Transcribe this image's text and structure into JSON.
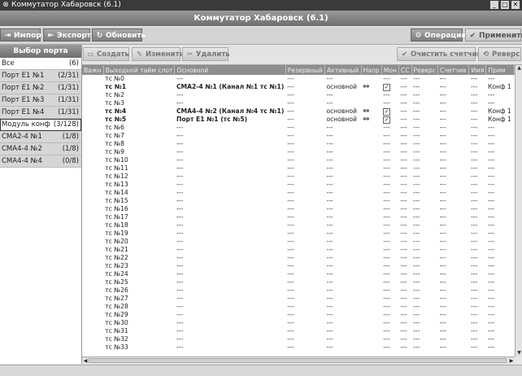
{
  "window": {
    "title": "Коммутатор Хабаровск (6.1)"
  },
  "app": {
    "header": "Коммутатор Хабаровск (6.1)"
  },
  "toolbar": {
    "import": "Импорт",
    "export": "Экспорт",
    "refresh": "Обновить",
    "operations": "Операции",
    "apply": "Применить"
  },
  "sidebar": {
    "header": "Выбор порта",
    "ports": [
      {
        "label": "Все",
        "count": "(6)"
      },
      {
        "label": "Порт E1 №1",
        "count": "(2/31)"
      },
      {
        "label": "Порт E1 №2",
        "count": "(1/31)"
      },
      {
        "label": "Порт E1 №3",
        "count": "(1/31)"
      },
      {
        "label": "Порт E1 №4",
        "count": "(1/31)"
      },
      {
        "label": "Модуль конф",
        "count": "(3/128)"
      },
      {
        "label": "СМА2-4 №1",
        "count": "(1/8)"
      },
      {
        "label": "СМА4-4 №2",
        "count": "(1/8)"
      },
      {
        "label": "СМА4-4 №4",
        "count": "(0/8)"
      }
    ]
  },
  "actions": {
    "create": "Создать",
    "edit": "Изменить",
    "delete": "Удалить",
    "clear_counter": "Очистить счетчик",
    "reverse": "Реверс"
  },
  "table": {
    "columns": [
      "Важн",
      "Выходной тайм слот",
      "Основной",
      "Резервный",
      "Активный",
      "Напр",
      "Мон",
      "СС",
      "Реверс",
      "Счетчик",
      "Имя",
      "Прим"
    ],
    "rows": [
      {
        "slot": "тс №0",
        "main": "---",
        "reserve": "---",
        "active": "---",
        "dir": "",
        "mon": "---",
        "cc": "---",
        "rev": "---",
        "cnt": "---",
        "name": "---",
        "note": "---"
      },
      {
        "slot": "тс №1",
        "main": "СМА2-4 №1 (Канал №1 тс №1)",
        "reserve": "---",
        "active": "основной",
        "dir": "⇔",
        "mon": "✓",
        "cc": "---",
        "rev": "---",
        "cnt": "---",
        "name": "---",
        "note": "Конф 1"
      },
      {
        "slot": "тс №2",
        "main": "---",
        "reserve": "---",
        "active": "---",
        "dir": "",
        "mon": "---",
        "cc": "---",
        "rev": "---",
        "cnt": "---",
        "name": "---",
        "note": "---"
      },
      {
        "slot": "тс №3",
        "main": "---",
        "reserve": "---",
        "active": "---",
        "dir": "",
        "mon": "---",
        "cc": "---",
        "rev": "---",
        "cnt": "---",
        "name": "---",
        "note": "---"
      },
      {
        "slot": "тс №4",
        "main": "СМА4-4 №2 (Канал №4 тс №1)",
        "reserve": "---",
        "active": "основной",
        "dir": "⇔",
        "mon": "✓",
        "cc": "---",
        "rev": "---",
        "cnt": "---",
        "name": "---",
        "note": "Конф 1"
      },
      {
        "slot": "тс №5",
        "main": "Порт E1 №1 (тс №5)",
        "reserve": "---",
        "active": "основной",
        "dir": "⇔",
        "mon": "✓",
        "cc": "---",
        "rev": "---",
        "cnt": "---",
        "name": "---",
        "note": "Конф 1"
      },
      {
        "slot": "тс №6",
        "main": "---",
        "reserve": "---",
        "active": "---",
        "dir": "",
        "mon": "---",
        "cc": "---",
        "rev": "---",
        "cnt": "---",
        "name": "---",
        "note": "---"
      },
      {
        "slot": "тс №7",
        "main": "---",
        "reserve": "---",
        "active": "---",
        "dir": "",
        "mon": "---",
        "cc": "---",
        "rev": "---",
        "cnt": "---",
        "name": "---",
        "note": "---"
      },
      {
        "slot": "тс №8",
        "main": "---",
        "reserve": "---",
        "active": "---",
        "dir": "",
        "mon": "---",
        "cc": "---",
        "rev": "---",
        "cnt": "---",
        "name": "---",
        "note": "---"
      },
      {
        "slot": "тс №9",
        "main": "---",
        "reserve": "---",
        "active": "---",
        "dir": "",
        "mon": "---",
        "cc": "---",
        "rev": "---",
        "cnt": "---",
        "name": "---",
        "note": "---"
      },
      {
        "slot": "тс №10",
        "main": "---",
        "reserve": "---",
        "active": "---",
        "dir": "",
        "mon": "---",
        "cc": "---",
        "rev": "---",
        "cnt": "---",
        "name": "---",
        "note": "---"
      },
      {
        "slot": "тс №11",
        "main": "---",
        "reserve": "---",
        "active": "---",
        "dir": "",
        "mon": "---",
        "cc": "---",
        "rev": "---",
        "cnt": "---",
        "name": "---",
        "note": "---"
      },
      {
        "slot": "тс №12",
        "main": "---",
        "reserve": "---",
        "active": "---",
        "dir": "",
        "mon": "---",
        "cc": "---",
        "rev": "---",
        "cnt": "---",
        "name": "---",
        "note": "---"
      },
      {
        "slot": "тс №13",
        "main": "---",
        "reserve": "---",
        "active": "---",
        "dir": "",
        "mon": "---",
        "cc": "---",
        "rev": "---",
        "cnt": "---",
        "name": "---",
        "note": "---"
      },
      {
        "slot": "тс №14",
        "main": "---",
        "reserve": "---",
        "active": "---",
        "dir": "",
        "mon": "---",
        "cc": "---",
        "rev": "---",
        "cnt": "---",
        "name": "---",
        "note": "---"
      },
      {
        "slot": "тс №15",
        "main": "---",
        "reserve": "---",
        "active": "---",
        "dir": "",
        "mon": "---",
        "cc": "---",
        "rev": "---",
        "cnt": "---",
        "name": "---",
        "note": "---"
      },
      {
        "slot": "тс №16",
        "main": "---",
        "reserve": "---",
        "active": "---",
        "dir": "",
        "mon": "---",
        "cc": "---",
        "rev": "---",
        "cnt": "---",
        "name": "---",
        "note": "---"
      },
      {
        "slot": "тс №17",
        "main": "---",
        "reserve": "---",
        "active": "---",
        "dir": "",
        "mon": "---",
        "cc": "---",
        "rev": "---",
        "cnt": "---",
        "name": "---",
        "note": "---"
      },
      {
        "slot": "тс №18",
        "main": "---",
        "reserve": "---",
        "active": "---",
        "dir": "",
        "mon": "---",
        "cc": "---",
        "rev": "---",
        "cnt": "---",
        "name": "---",
        "note": "---"
      },
      {
        "slot": "тс №19",
        "main": "---",
        "reserve": "---",
        "active": "---",
        "dir": "",
        "mon": "---",
        "cc": "---",
        "rev": "---",
        "cnt": "---",
        "name": "---",
        "note": "---"
      },
      {
        "slot": "тс №20",
        "main": "---",
        "reserve": "---",
        "active": "---",
        "dir": "",
        "mon": "---",
        "cc": "---",
        "rev": "---",
        "cnt": "---",
        "name": "---",
        "note": "---"
      },
      {
        "slot": "тс №21",
        "main": "---",
        "reserve": "---",
        "active": "---",
        "dir": "",
        "mon": "---",
        "cc": "---",
        "rev": "---",
        "cnt": "---",
        "name": "---",
        "note": "---"
      },
      {
        "slot": "тс №22",
        "main": "---",
        "reserve": "---",
        "active": "---",
        "dir": "",
        "mon": "---",
        "cc": "---",
        "rev": "---",
        "cnt": "---",
        "name": "---",
        "note": "---"
      },
      {
        "slot": "тс №23",
        "main": "---",
        "reserve": "---",
        "active": "---",
        "dir": "",
        "mon": "---",
        "cc": "---",
        "rev": "---",
        "cnt": "---",
        "name": "---",
        "note": "---"
      },
      {
        "slot": "тс №24",
        "main": "---",
        "reserve": "---",
        "active": "---",
        "dir": "",
        "mon": "---",
        "cc": "---",
        "rev": "---",
        "cnt": "---",
        "name": "---",
        "note": "---"
      },
      {
        "slot": "тс №25",
        "main": "---",
        "reserve": "---",
        "active": "---",
        "dir": "",
        "mon": "---",
        "cc": "---",
        "rev": "---",
        "cnt": "---",
        "name": "---",
        "note": "---"
      },
      {
        "slot": "тс №26",
        "main": "---",
        "reserve": "---",
        "active": "---",
        "dir": "",
        "mon": "---",
        "cc": "---",
        "rev": "---",
        "cnt": "---",
        "name": "---",
        "note": "---"
      },
      {
        "slot": "тс №27",
        "main": "---",
        "reserve": "---",
        "active": "---",
        "dir": "",
        "mon": "---",
        "cc": "---",
        "rev": "---",
        "cnt": "---",
        "name": "---",
        "note": "---"
      },
      {
        "slot": "тс №28",
        "main": "---",
        "reserve": "---",
        "active": "---",
        "dir": "",
        "mon": "---",
        "cc": "---",
        "rev": "---",
        "cnt": "---",
        "name": "---",
        "note": "---"
      },
      {
        "slot": "тс №29",
        "main": "---",
        "reserve": "---",
        "active": "---",
        "dir": "",
        "mon": "---",
        "cc": "---",
        "rev": "---",
        "cnt": "---",
        "name": "---",
        "note": "---"
      },
      {
        "slot": "тс №30",
        "main": "---",
        "reserve": "---",
        "active": "---",
        "dir": "",
        "mon": "---",
        "cc": "---",
        "rev": "---",
        "cnt": "---",
        "name": "---",
        "note": "---"
      },
      {
        "slot": "тс №31",
        "main": "---",
        "reserve": "---",
        "active": "---",
        "dir": "",
        "mon": "---",
        "cc": "---",
        "rev": "---",
        "cnt": "---",
        "name": "---",
        "note": "---"
      },
      {
        "slot": "тс №32",
        "main": "---",
        "reserve": "---",
        "active": "---",
        "dir": "",
        "mon": "---",
        "cc": "---",
        "rev": "---",
        "cnt": "---",
        "name": "---",
        "note": "---"
      },
      {
        "slot": "тс №33",
        "main": "---",
        "reserve": "---",
        "active": "---",
        "dir": "",
        "mon": "---",
        "cc": "---",
        "rev": "---",
        "cnt": "---",
        "name": "---",
        "note": "---"
      }
    ]
  }
}
